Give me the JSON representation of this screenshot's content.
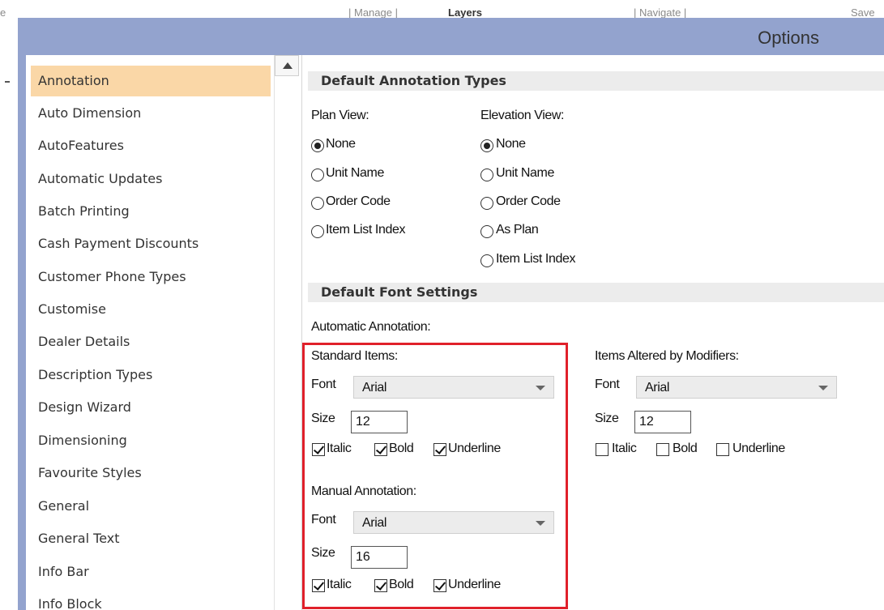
{
  "background": {
    "fragments": [
      "e",
      "| Manage |",
      "Layers",
      "| Navigate |",
      "Save"
    ]
  },
  "window": {
    "title": "Options"
  },
  "sidebar": {
    "items": [
      {
        "label": "Annotation",
        "active": true
      },
      {
        "label": "Auto Dimension"
      },
      {
        "label": "AutoFeatures"
      },
      {
        "label": "Automatic Updates"
      },
      {
        "label": "Batch Printing"
      },
      {
        "label": "Cash Payment Discounts"
      },
      {
        "label": "Customer Phone Types"
      },
      {
        "label": "Customise"
      },
      {
        "label": "Dealer Details"
      },
      {
        "label": "Description Types"
      },
      {
        "label": "Design Wizard"
      },
      {
        "label": "Dimensioning"
      },
      {
        "label": "Favourite Styles"
      },
      {
        "label": "General"
      },
      {
        "label": "General Text"
      },
      {
        "label": "Info Bar"
      },
      {
        "label": "Info Block"
      }
    ]
  },
  "annotation_types": {
    "header": "Default Annotation Types",
    "plan_view": {
      "label": "Plan View:",
      "options": [
        "None",
        "Unit Name",
        "Order Code",
        "Item List Index"
      ],
      "selected": "None"
    },
    "elevation_view": {
      "label": "Elevation View:",
      "options": [
        "None",
        "Unit Name",
        "Order Code",
        "As Plan",
        "Item List Index"
      ],
      "selected": "None"
    }
  },
  "font_settings": {
    "header": "Default Font Settings",
    "automatic_label": "Automatic Annotation:",
    "font_label": "Font",
    "size_label": "Size",
    "italic_label": "Italic",
    "bold_label": "Bold",
    "underline_label": "Underline",
    "standard": {
      "label": "Standard Items:",
      "font": "Arial",
      "size": "12",
      "italic": true,
      "bold": true,
      "underline": true
    },
    "modified": {
      "label": "Items Altered by Modifiers:",
      "font": "Arial",
      "size": "12",
      "italic": false,
      "bold": false,
      "underline": false
    },
    "manual": {
      "label": "Manual Annotation:",
      "font": "Arial",
      "size": "16",
      "italic": true,
      "bold": true,
      "underline": true
    }
  },
  "colors": {
    "titlebar": "#93a3ce",
    "selection": "#fad7a7",
    "highlight_box": "#e0202a"
  }
}
